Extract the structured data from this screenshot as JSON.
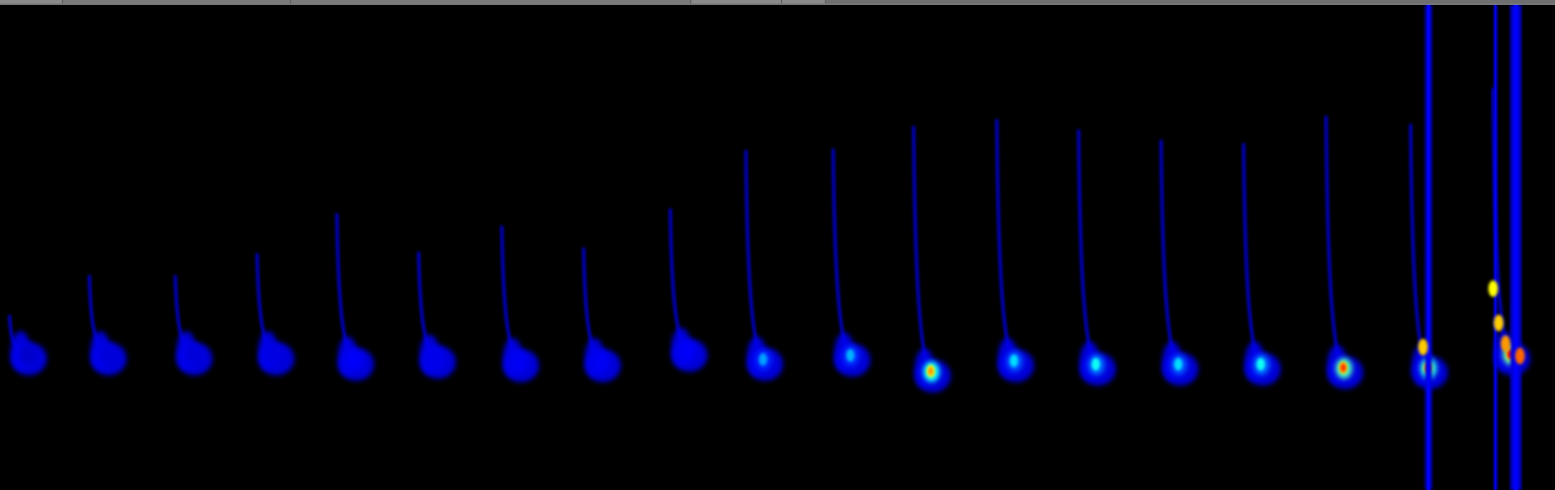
{
  "view": {
    "type": "spectrogram",
    "colormap": [
      "#000080",
      "#0000ff",
      "#00ffff",
      "#ffff00",
      "#ff0000"
    ],
    "background": "#000000",
    "frame_color": "#6f6f6f"
  },
  "calls": {
    "count": 19,
    "shape": "downward frequency-modulated sweep ending in a bright tail",
    "peak_intensity": [
      0.25,
      0.3,
      0.3,
      0.32,
      0.4,
      0.35,
      0.38,
      0.38,
      0.4,
      0.48,
      0.5,
      0.85,
      0.55,
      0.6,
      0.55,
      0.6,
      0.95,
      0.9,
      1.0
    ]
  },
  "vertical_lines": {
    "count": 3
  }
}
